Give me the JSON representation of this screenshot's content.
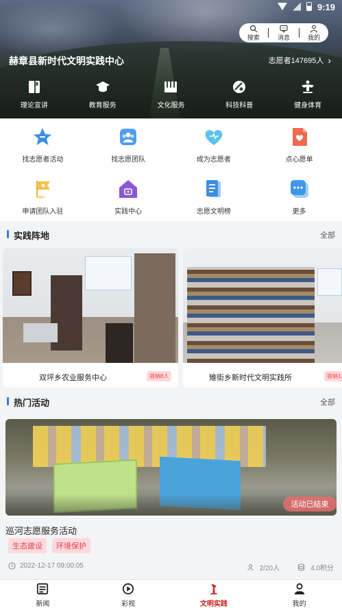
{
  "status_bar": {
    "time": "9:19"
  },
  "header": {
    "search_label": "搜索",
    "message_label": "消息",
    "mine_label": "我的",
    "org_title": "赫章县新时代文明实践中心",
    "volunteer_count": "志愿者147695人"
  },
  "categories": [
    {
      "label": "理论宣讲",
      "icon": "book-icon"
    },
    {
      "label": "教育服务",
      "icon": "graduation-cap-icon"
    },
    {
      "label": "文化服务",
      "icon": "piano-icon"
    },
    {
      "label": "科技科普",
      "icon": "satellite-icon"
    },
    {
      "label": "健身体育",
      "icon": "fitness-icon"
    }
  ],
  "services": [
    {
      "label": "找志愿者活动",
      "icon": "star-icon"
    },
    {
      "label": "找志愿团队",
      "icon": "team-icon"
    },
    {
      "label": "成为志愿者",
      "icon": "heart-icon"
    },
    {
      "label": "点心愿单",
      "icon": "wish-list-icon"
    },
    {
      "label": "申请团队入驻",
      "icon": "flag-icon"
    },
    {
      "label": "实践中心",
      "icon": "home-icon"
    },
    {
      "label": "志愿文明榜",
      "icon": "document-icon"
    },
    {
      "label": "更多",
      "icon": "more-icon"
    }
  ],
  "practice": {
    "section_title": "实践阵地",
    "more_label": "全部",
    "cards": [
      {
        "name": "双坪乡农业服务中心",
        "capacity": "容纳8人"
      },
      {
        "name": "雉街乡新时代文明实践所",
        "capacity": "容纳1"
      }
    ]
  },
  "activities": {
    "section_title": "热门活动",
    "more_label": "全部",
    "item": {
      "title": "巡河志愿服务活动",
      "status": "活动已结束",
      "tags": [
        "生态建设",
        "环境保护"
      ],
      "time": "2022-12-17 09:00:05",
      "participants": "2/20人",
      "points": "4.0积分"
    }
  },
  "tabbar": [
    {
      "label": "新闻",
      "icon": "news-icon"
    },
    {
      "label": "彩视",
      "icon": "play-icon"
    },
    {
      "label": "文明实践",
      "icon": "torch-icon",
      "active": true
    },
    {
      "label": "我的",
      "icon": "person-icon"
    }
  ],
  "colors": {
    "accent": "#2f7ce3",
    "tab_active": "#c81e1e",
    "tag_text": "#e0434d",
    "tag_bg": "#fdd9dd"
  }
}
